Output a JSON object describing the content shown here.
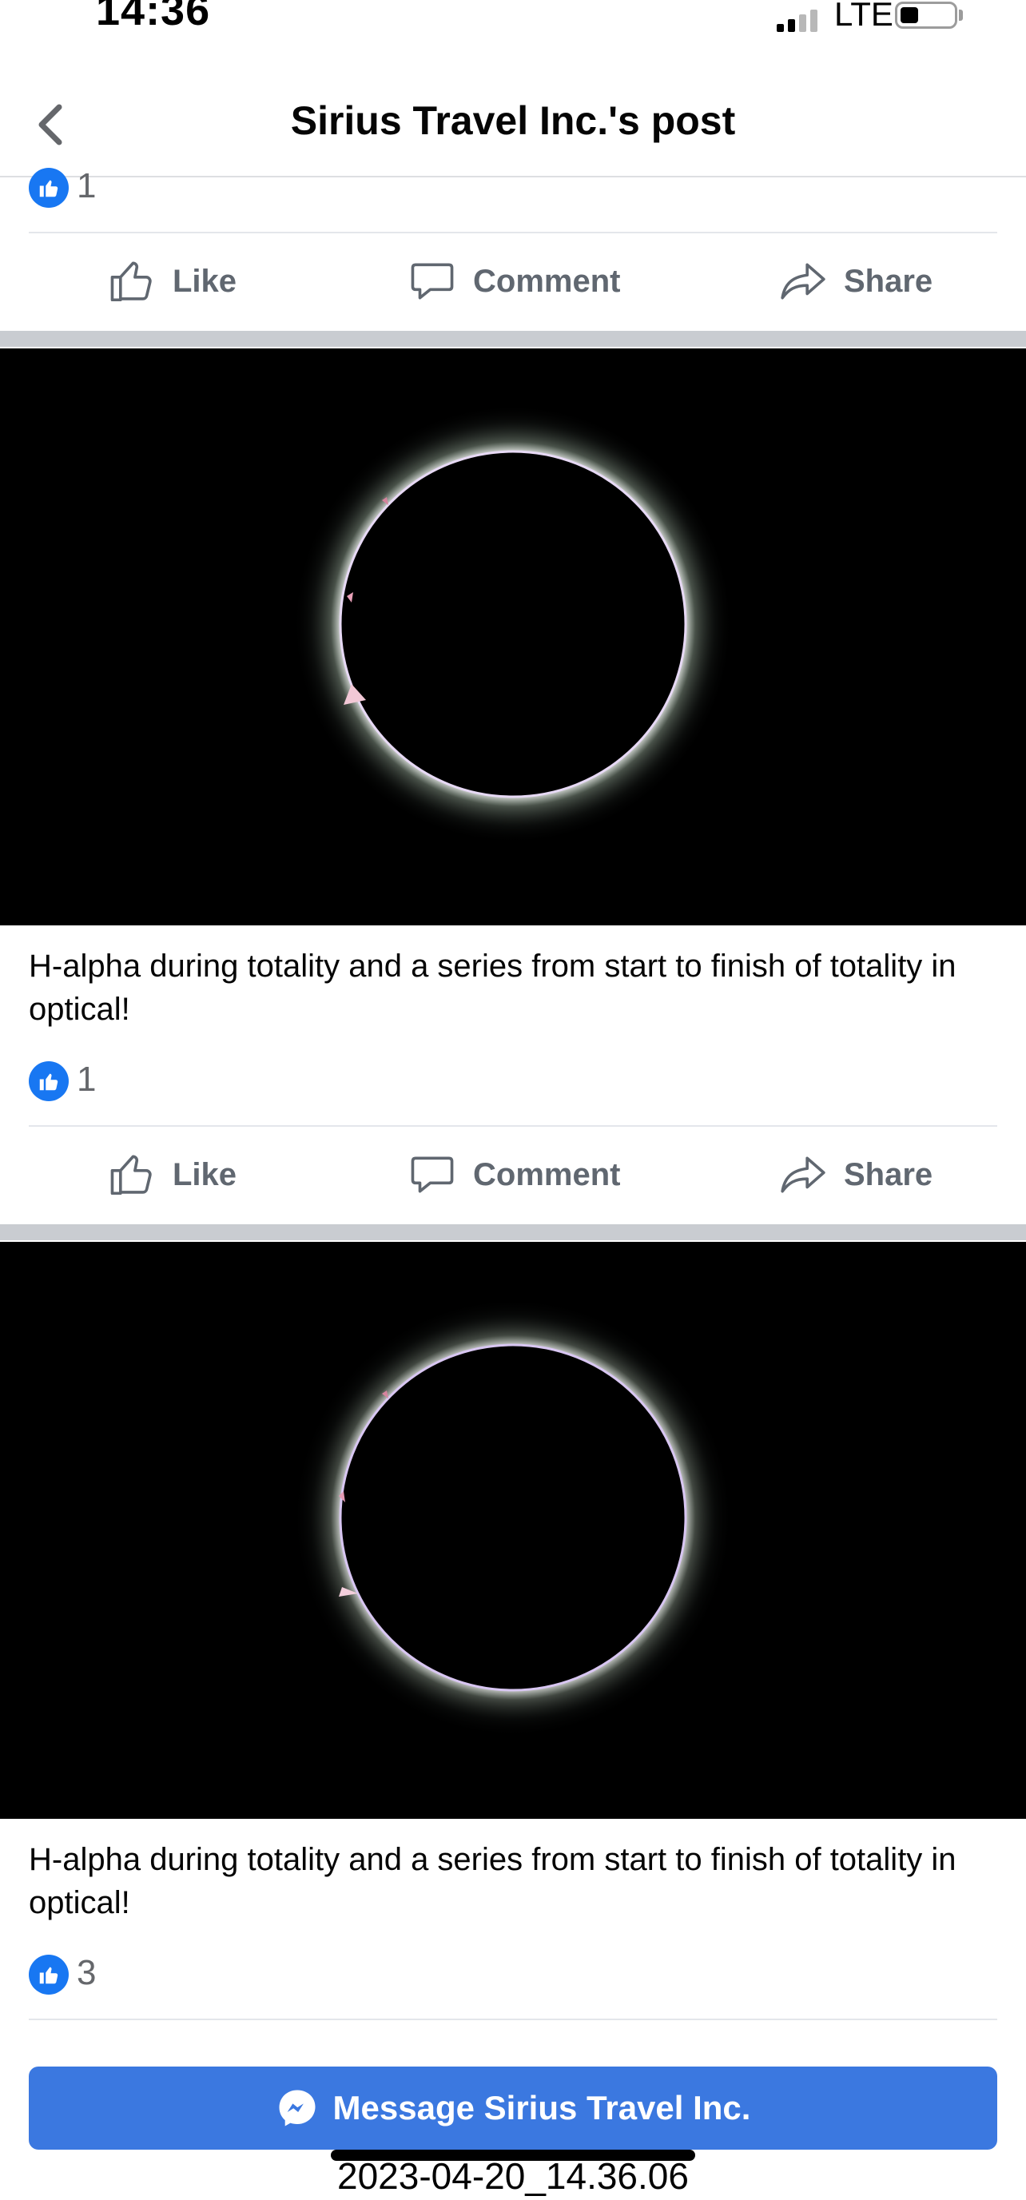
{
  "status_bar": {
    "time": "14:36",
    "network": "LTE"
  },
  "header": {
    "title": "Sirius Travel Inc.'s post",
    "back_icon": "chevron-left-icon"
  },
  "posts": [
    {
      "likes": "1",
      "actions": {
        "like": "Like",
        "comment": "Comment",
        "share": "Share"
      }
    },
    {
      "image": "total-solar-eclipse-h-alpha-photo",
      "caption": "H-alpha during totality and a series from start to finish of totality in optical!",
      "likes": "1",
      "actions": {
        "like": "Like",
        "comment": "Comment",
        "share": "Share"
      }
    },
    {
      "image": "total-solar-eclipse-optical-photo",
      "caption": "H-alpha during totality and a series from start to finish of totality in optical!",
      "likes": "3"
    }
  ],
  "footer": {
    "message_button": "Message Sirius Travel Inc.",
    "timestamp": "2023-04-20_14.36.06"
  },
  "colors": {
    "facebook_blue": "#1877f2",
    "message_button": "#3b78e0",
    "action_text": "#606770",
    "separator": "#c9ccd1"
  }
}
